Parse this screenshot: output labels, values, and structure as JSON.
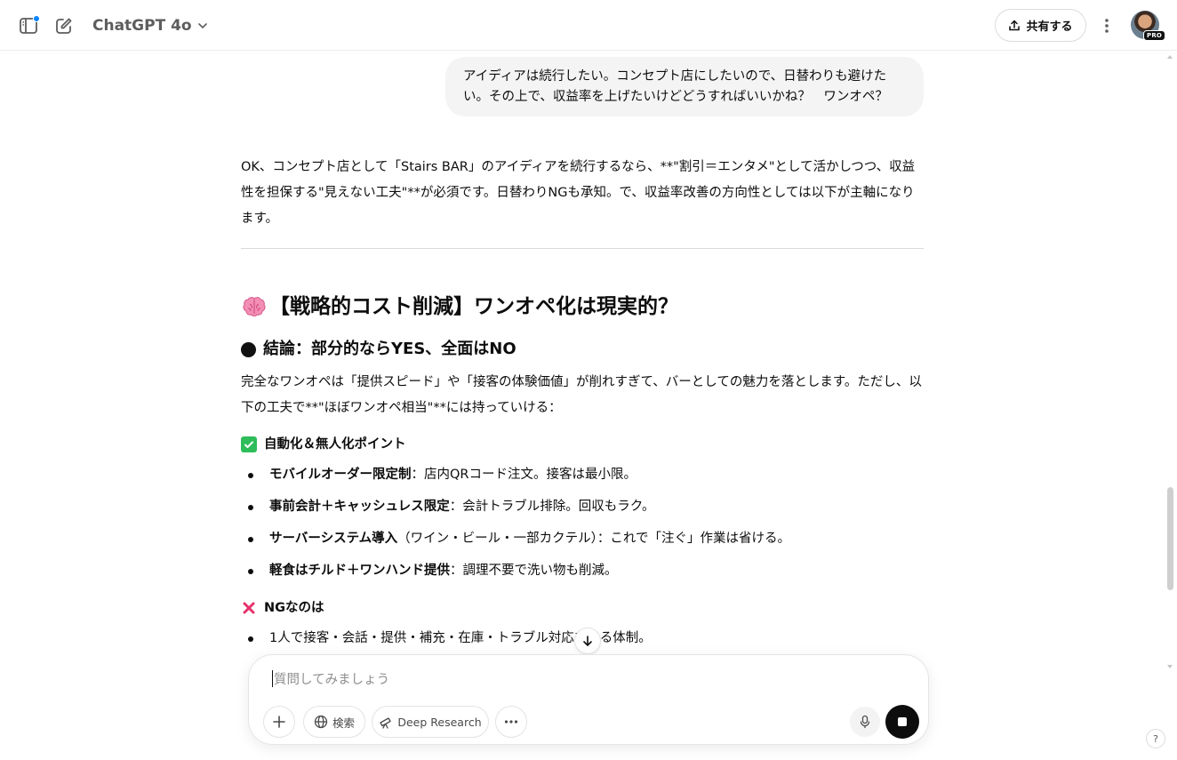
{
  "header": {
    "model_name": "ChatGPT 4o",
    "share_label": "共有する",
    "pro_badge": "PRO"
  },
  "conversation": {
    "user_message": "アイディアは続行したい。コンセプト店にしたいので、日替わりも避けたい。その上で、収益率を上げたいけどどうすればいいかね？　ワンオペ？",
    "assistant": {
      "intro": "OK、コンセプト店として「Stairs BAR」のアイディアを続行するなら、**\"割引＝エンタメ\"として活かしつつ、収益性を担保する\"見えない工夫\"**が必須です。日替わりNGも承知。で、収益率改善の方向性としては以下が主軸になります。",
      "heading": "【戦略的コスト削減】ワンオペ化は現実的？",
      "subheading": "結論：部分的ならYES、全面はNO",
      "summary": "完全なワンオペは「提供スピード」や「接客の体験価値」が削れすぎて、バーとしての魅力を落とします。ただし、以下の工夫で**\"ほぼワンオペ相当\"**には持っていける：",
      "section_ok": {
        "title": "自動化＆無人化ポイント",
        "items": [
          {
            "bold": "モバイルオーダー限定制",
            "text": "：店内QRコード注文。接客は最小限。"
          },
          {
            "bold": "事前会計＋キャッシュレス限定",
            "text": "：会計トラブル排除。回収もラク。"
          },
          {
            "bold": "サーバーシステム導入",
            "text": "（ワイン・ビール・一部カクテル）：これで「注ぐ」作業は省ける。"
          },
          {
            "bold": "軽食はチルド＋ワンハンド提供",
            "text": "：調理不要で洗い物も削減。"
          }
        ]
      },
      "section_ng": {
        "title": "NGなのは",
        "items": [
          {
            "text": "1人で接客・会話・提供・補充・在庫・トラブル対応をやる体制。"
          }
        ]
      }
    }
  },
  "composer": {
    "placeholder": "質問してみましょう",
    "search_label": "検索",
    "deep_research_label": "Deep Research"
  },
  "help_label": "?",
  "colors": {
    "user_bubble": "#f4f4f4",
    "check_green": "#2fbd5b",
    "cross_red": "#e5336b",
    "notification_blue": "#0a84ff"
  }
}
